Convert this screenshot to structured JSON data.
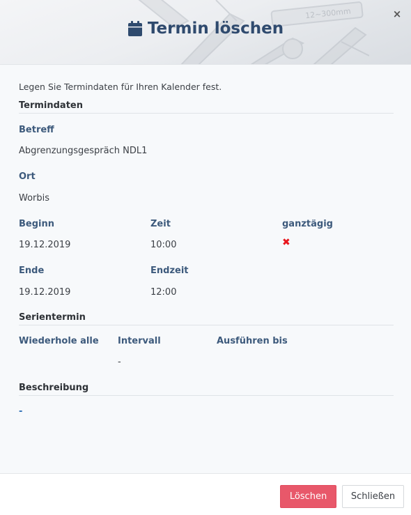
{
  "header": {
    "title": "Termin löschen",
    "icon": "calendar-icon",
    "close_label": "×"
  },
  "intro": "Legen Sie Termindaten für Ihren Kalender fest.",
  "termindaten": {
    "section_title": "Termindaten",
    "betreff_label": "Betreff",
    "betreff_value": "Abgrenzungsgespräch NDL1",
    "ort_label": "Ort",
    "ort_value": "Worbis",
    "beginn_label": "Beginn",
    "beginn_value": "19.12.2019",
    "zeit_label": "Zeit",
    "zeit_value": "10:00",
    "ganztaegig_label": "ganztägig",
    "ganztaegig_value": "✖",
    "ende_label": "Ende",
    "ende_value": "19.12.2019",
    "endzeit_label": "Endzeit",
    "endzeit_value": "12:00"
  },
  "serientermin": {
    "section_title": "Serientermin",
    "wiederhole_label": "Wiederhole alle",
    "intervall_label": "Intervall",
    "intervall_value": "-",
    "ausfuehren_label": "Ausführen bis"
  },
  "beschreibung": {
    "section_title": "Beschreibung",
    "value": "-"
  },
  "footer": {
    "delete_label": "Löschen",
    "close_label": "Schließen"
  },
  "colors": {
    "title": "#2f4a6e",
    "label": "#3d5a7c",
    "delete_button": "#e8586a",
    "cross": "#e8161d"
  }
}
